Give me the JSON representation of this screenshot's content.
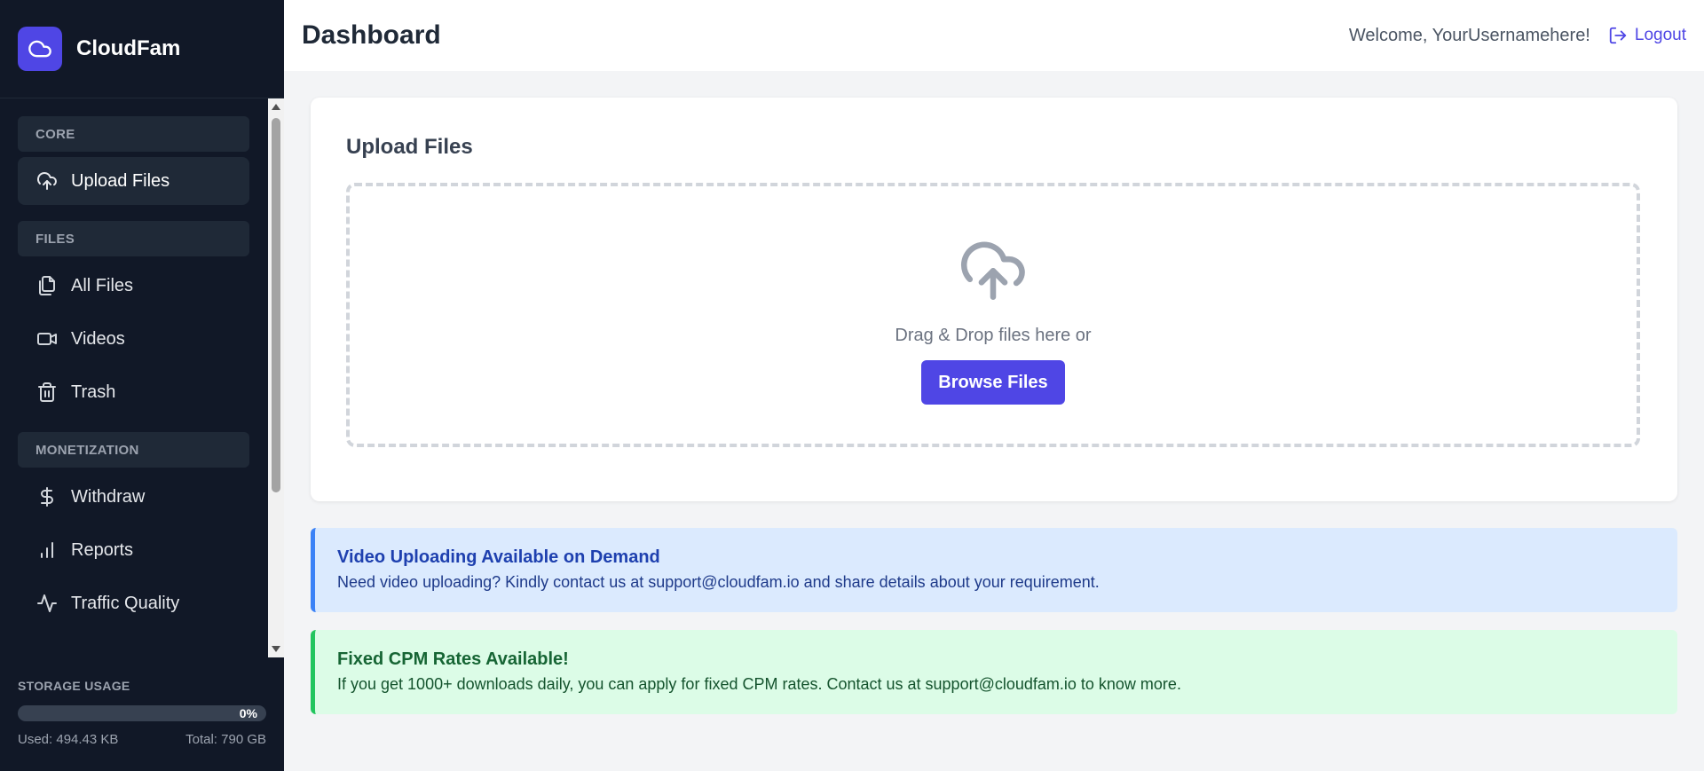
{
  "brand": {
    "name": "CloudFam"
  },
  "sidebar": {
    "sections": [
      {
        "label": "CORE",
        "items": [
          {
            "label": "Upload Files",
            "icon": "cloud-upload-icon",
            "active": true
          }
        ]
      },
      {
        "label": "FILES",
        "items": [
          {
            "label": "All Files",
            "icon": "files-icon"
          },
          {
            "label": "Videos",
            "icon": "video-icon"
          },
          {
            "label": "Trash",
            "icon": "trash-icon"
          }
        ]
      },
      {
        "label": "MONETIZATION",
        "items": [
          {
            "label": "Withdraw",
            "icon": "dollar-icon"
          },
          {
            "label": "Reports",
            "icon": "bar-chart-icon"
          },
          {
            "label": "Traffic Quality",
            "icon": "activity-icon"
          }
        ]
      }
    ]
  },
  "storage": {
    "title": "STORAGE USAGE",
    "percent_label": "0%",
    "percent": 0,
    "used": "Used: 494.43 KB",
    "total": "Total: 790 GB"
  },
  "header": {
    "title": "Dashboard",
    "welcome": "Welcome, YourUsernamehere!",
    "logout_label": "Logout"
  },
  "upload": {
    "title": "Upload Files",
    "drop_text": "Drag & Drop files here or",
    "browse_label": "Browse Files"
  },
  "alerts": {
    "video": {
      "title": "Video Uploading Available on Demand",
      "text": "Need video uploading? Kindly contact us at support@cloudfam.io and share details about your requirement."
    },
    "cpm": {
      "title": "Fixed CPM Rates Available!",
      "text": "If you get 1000+ downloads daily, you can apply for fixed CPM rates. Contact us at support@cloudfam.io to know more."
    }
  },
  "colors": {
    "accent": "#4f46e5",
    "sidebar_bg": "#111827",
    "info_bg": "#dbeafe",
    "success_bg": "#dcfce7"
  }
}
